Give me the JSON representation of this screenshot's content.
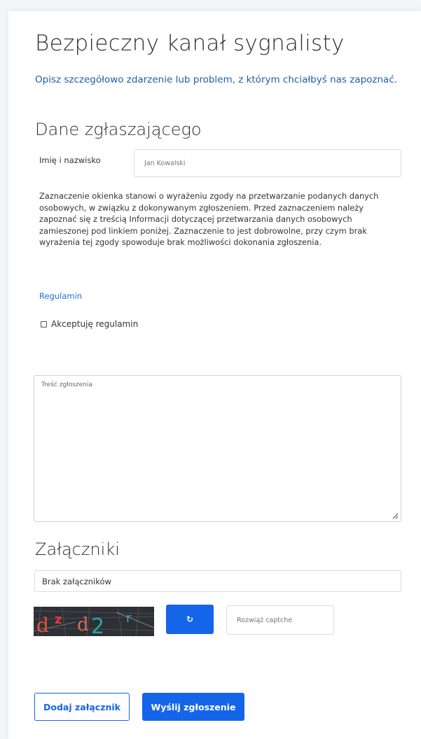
{
  "header": {
    "title": "Bezpieczny kanał sygnalisty",
    "subtitle": "Opisz szczegółowo zdarzenie lub problem, z którym chciałbyś nas zapoznać."
  },
  "reporter_section": {
    "title": "Dane zgłaszającego",
    "name_label": "Imię i nazwisko",
    "name_placeholder": "Jan Kowalski",
    "consent_text": "Zaznaczenie okienka stanowi o wyrażeniu zgody na przetwarzanie podanych danych osobowych, w związku z dokonywanym zgłoszeniem. Przed zaznaczeniem należy zapoznać się z treścią Informacji dotyczącej przetwarzania danych osobowych zamieszonej pod linkiem poniżej. Zaznaczenie to jest dobrowolne, przy czym brak wyrażenia tej zgody spowoduje brak możliwości dokonania zgłoszenia.",
    "terms_link": "Regulamin",
    "accept_label": "Akceptuję regulamin",
    "accept_checked": false
  },
  "report": {
    "placeholder": "Treść zgłoszenia"
  },
  "attachments_section": {
    "title": "Załączniki",
    "empty_text": "Brak załączników"
  },
  "captcha": {
    "text": "dzd2r",
    "refresh_symbol": "↻",
    "input_placeholder": "Rozwiąż captche"
  },
  "actions": {
    "add_attachment": "Dodaj załącznik",
    "submit": "Wyślij zgłoszenie"
  },
  "colors": {
    "primary": "#1565e8",
    "subtitle": "#1f5fa8",
    "link": "#1f6fe0"
  }
}
